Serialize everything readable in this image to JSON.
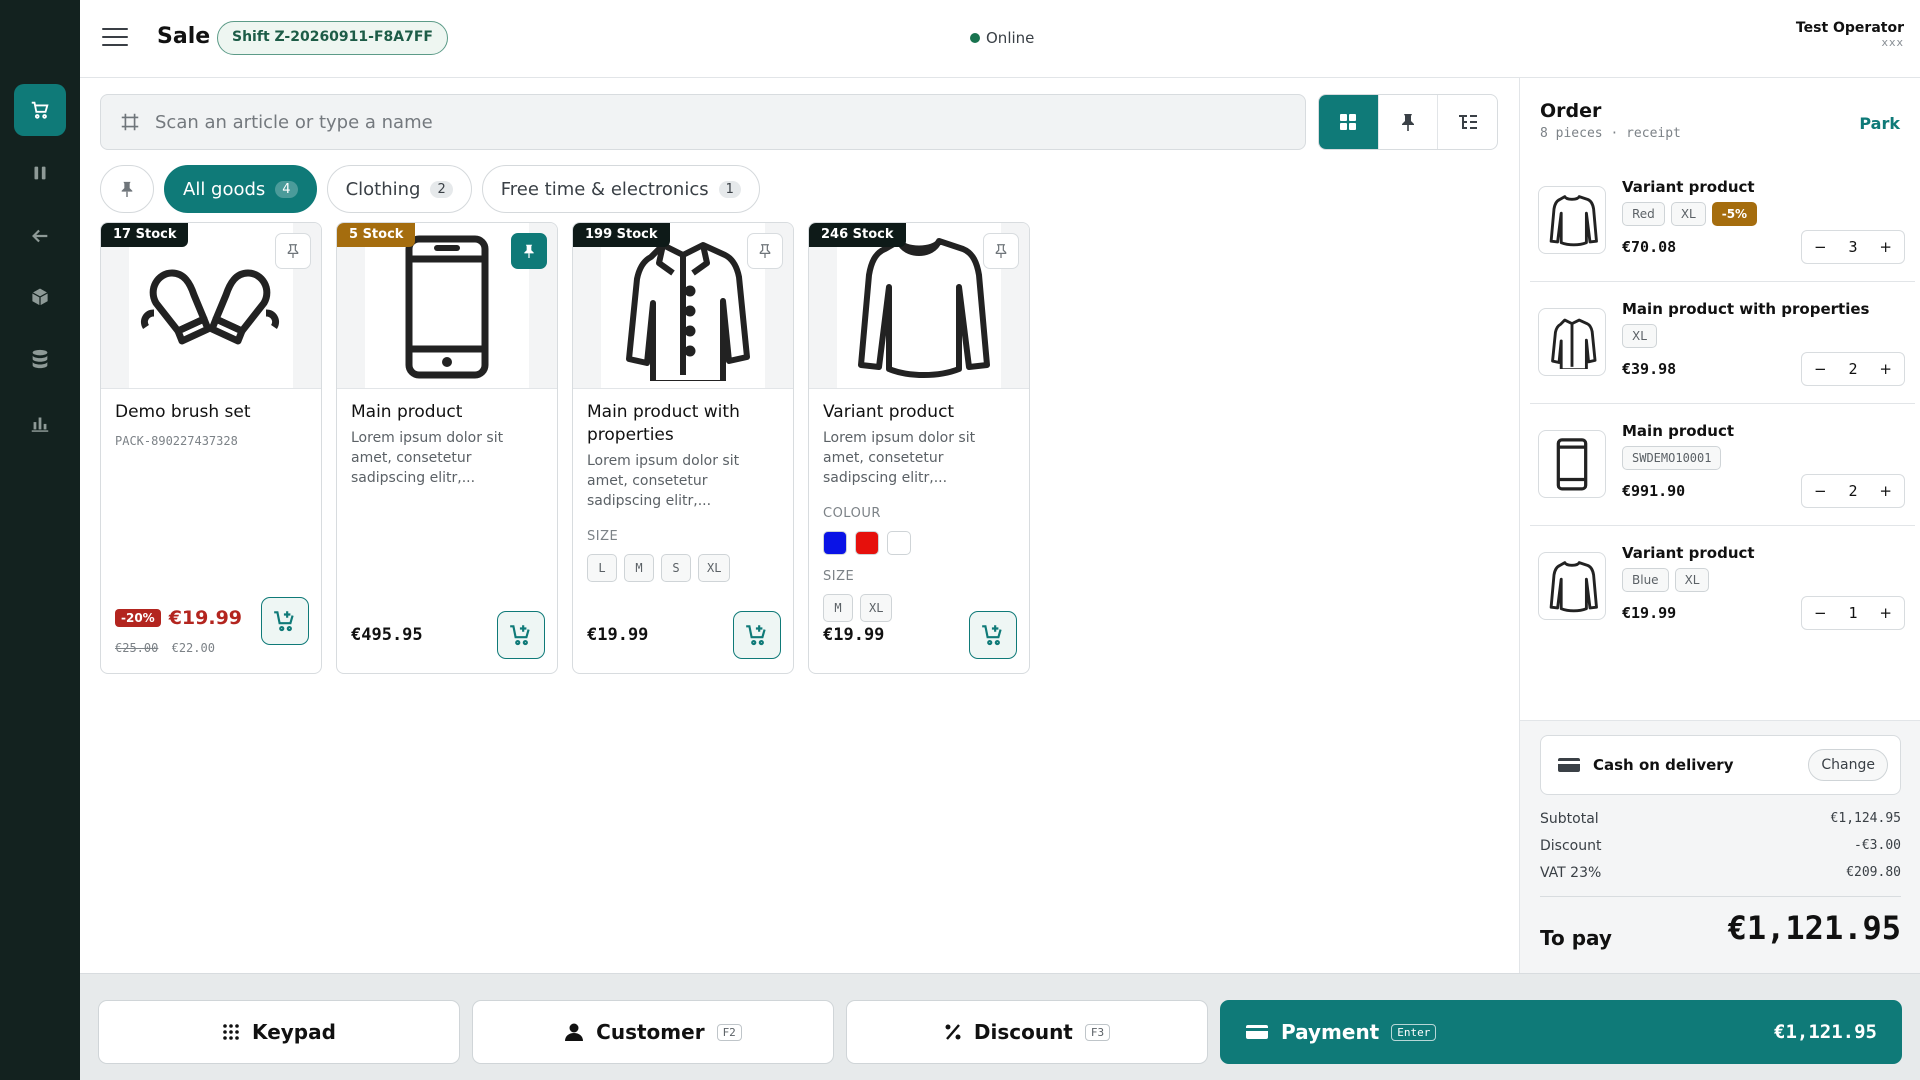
{
  "header": {
    "title": "Sale",
    "shift": "Shift Z-20260911-F8A7FF",
    "status": "Online",
    "operator_name": "Test Operator",
    "operator_sub": "xxx"
  },
  "search": {
    "placeholder": "Scan an article or type a name"
  },
  "categories": [
    {
      "label": "All goods",
      "count": "4",
      "active": true
    },
    {
      "label": "Clothing",
      "count": "2",
      "active": false
    },
    {
      "label": "Free time & electronics",
      "count": "1",
      "active": false
    }
  ],
  "products": [
    {
      "stock": "17 Stock",
      "name": "Demo brush set",
      "sku": "PACK-890227437328",
      "discount": "-20%",
      "price": "€19.99",
      "old_price": "€25.00",
      "prev_price": "€22.00",
      "pinned": false,
      "icon": "mittens-icon"
    },
    {
      "stock": "5 Stock",
      "name": "Main product",
      "desc": "Lorem ipsum dolor sit amet, consetetur sadipscing elitr,...",
      "price": "€495.95",
      "pinned": true,
      "icon": "smartphone-icon"
    },
    {
      "stock": "199 Stock",
      "name": "Main product with properties",
      "desc": "Lorem ipsum dolor sit amet, consetetur sadipscing elitr,...",
      "size_label": "SIZE",
      "sizes": [
        "L",
        "M",
        "S",
        "XL"
      ],
      "price": "€19.99",
      "pinned": false,
      "icon": "jacket-icon"
    },
    {
      "stock": "246 Stock",
      "name": "Variant product",
      "desc": "Lorem ipsum dolor sit amet, consetetur sadipscing elitr,...",
      "colour_label": "COLOUR",
      "colours": [
        "#0a13e6",
        "#e6100c",
        "#ffffff"
      ],
      "size_label": "SIZE",
      "sizes": [
        "M",
        "XL"
      ],
      "price": "€19.99",
      "pinned": false,
      "icon": "sweater-icon"
    }
  ],
  "order": {
    "title": "Order",
    "subtitle": "8 pieces · receipt",
    "park": "Park",
    "items": [
      {
        "name": "Variant product",
        "tags": [
          "Red",
          "XL"
        ],
        "discount": "-5%",
        "price": "€70.08",
        "qty": "3",
        "icon": "sweater-icon"
      },
      {
        "name": "Main product with properties",
        "tags": [
          "XL"
        ],
        "price": "€39.98",
        "qty": "2",
        "icon": "jacket-icon"
      },
      {
        "name": "Main product",
        "tags": [
          "SWDEMO10001"
        ],
        "price": "€991.90",
        "qty": "2",
        "icon": "smartphone-icon"
      },
      {
        "name": "Variant product",
        "tags": [
          "Blue",
          "XL"
        ],
        "price": "€19.99",
        "qty": "1",
        "icon": "sweater-icon"
      }
    ],
    "payment_method": "Cash on delivery",
    "change": "Change",
    "subtotal_label": "Subtotal",
    "subtotal": "€1,124.95",
    "discount_label": "Discount",
    "discount": "-€3.00",
    "vat_label": "VAT 23%",
    "vat": "€209.80",
    "topay_label": "To pay",
    "topay": "€1,121.95"
  },
  "bottom": {
    "keypad": "Keypad",
    "customer": "Customer",
    "customer_key": "F2",
    "discount": "Discount",
    "discount_key": "F3",
    "payment": "Payment",
    "payment_key": "Enter",
    "payment_amount": "€1,121.95"
  },
  "colors": {
    "accent": "#0f7a78",
    "sidebar": "#13221f",
    "danger": "#b3251f",
    "warning": "#a56d0e"
  }
}
